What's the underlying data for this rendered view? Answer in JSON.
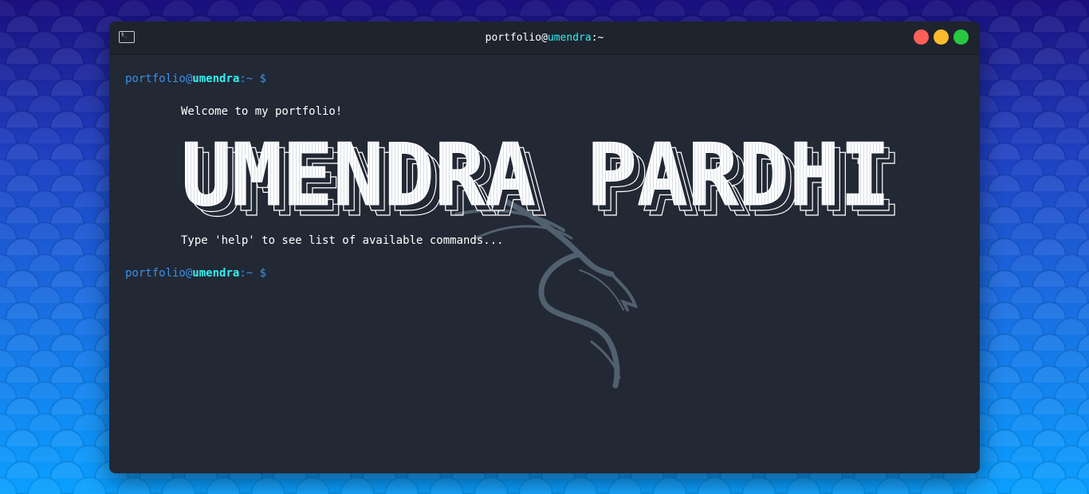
{
  "window": {
    "title_user": "portfolio",
    "title_at": "@",
    "title_host": "umendra",
    "title_suffix": ":~"
  },
  "terminal": {
    "prompt1": {
      "user": "portfolio",
      "at": "@",
      "host": "umendra",
      "path": ":~",
      "symbol": "$"
    },
    "welcome": "Welcome to my portfolio!",
    "banner_text": "UMENDRA PARDHI",
    "help_hint": "Type 'help' to see list of available commands...",
    "prompt2": {
      "user": "portfolio",
      "at": "@",
      "host": "umendra",
      "path": ":~",
      "symbol": "$"
    }
  },
  "colors": {
    "terminal_bg": "#222834",
    "titlebar_bg": "#1e232d",
    "host": "#2ff0f0",
    "user": "#3b8fe8",
    "close": "#fe5f57",
    "minimize": "#febc2e",
    "maximize": "#28c840"
  },
  "icons": {
    "terminal": "terminal-icon",
    "watermark": "kali-dragon-icon"
  }
}
